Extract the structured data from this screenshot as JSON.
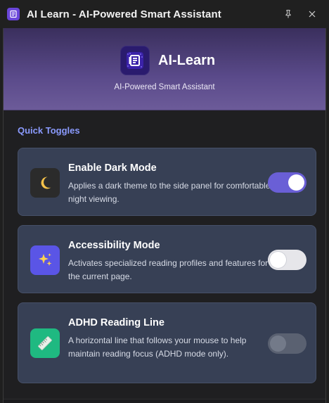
{
  "window": {
    "title": "AI Learn - AI-Powered Smart Assistant",
    "icons": {
      "app": "app-logo-icon",
      "pin": "pin-icon"
    }
  },
  "header": {
    "brand_name": "AI-Learn",
    "tagline": "AI-Powered Smart Assistant",
    "logo_icon": "ai-learn-logo-icon"
  },
  "section": {
    "title": "Quick Toggles"
  },
  "toggles": [
    {
      "title": "Enable Dark Mode",
      "description": "Applies a dark theme to the side panel for comfortable night viewing.",
      "icon": "moon-icon",
      "icon_bg": "#2b2b2b",
      "state": "on"
    },
    {
      "title": "Accessibility Mode",
      "description": "Activates specialized reading profiles and features for the current page.",
      "icon": "sparkles-icon",
      "icon_bg": "#5a55e6",
      "state": "off"
    },
    {
      "title": "ADHD Reading Line",
      "description": "A horizontal line that follows your mouse to help maintain reading focus (ADHD mode only).",
      "icon": "ruler-icon",
      "icon_bg": "#1fb981",
      "state": "disabled"
    }
  ],
  "colors": {
    "accent": "#8b9bff",
    "toggle_on": "#6a5fd6",
    "card_bg": "#374055"
  }
}
